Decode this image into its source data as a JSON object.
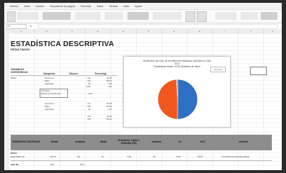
{
  "menu": [
    "Archivo",
    "Inicio",
    "Insertar",
    "Disposición de página",
    "Fórmulas",
    "Datos",
    "Revisar",
    "Vista",
    "Ayuda"
  ],
  "formula": {
    "cell": "J7",
    "fx": "fx",
    "value": ""
  },
  "columns": [
    "A",
    "B",
    "C",
    "D",
    "E",
    "F",
    "G",
    "H",
    "I",
    "J",
    "K"
  ],
  "title": "ESTADÍSTICA DESCRIPTIVA",
  "subtitle": "RESULTADOS",
  "section1": {
    "label": "VARIABLES CATEGÓRICAS",
    "headers": [
      "Categorías",
      "Número",
      "Porcentaje"
    ],
    "var_name": "SEXO",
    "rows": [
      [
        "Femenino",
        "712",
        "49.38"
      ],
      [
        "Masc",
        "730",
        "50.62"
      ],
      [
        "Indefinido",
        "10",
        "1.00"
      ],
      [
        "",
        "1442",
        "100"
      ]
    ]
  },
  "stat_box": {
    "row1": "Indicador",
    "row2": "Razón hombre/mujer",
    "value": "1.03"
  },
  "section1b": {
    "rows": [
      [
        "Femenino",
        "712",
        "49.38"
      ],
      [
        "Masc",
        "730",
        "50.62"
      ],
      [
        "Indefinido",
        "10",
        "1.00"
      ]
    ],
    "extra": [
      [
        "",
        "712",
        "49.38"
      ],
      [
        "",
        "730",
        "50.62"
      ]
    ]
  },
  "chart": {
    "title_line1": "Distribución por sexo de los diferentes individuos ocurridas en Chile",
    "title_line2": "2013",
    "title_line3": "Estadísticas Vitales, 2019, Ministerio de Salud",
    "legend": "Femenino",
    "colors": {
      "slice1": "#2f6fc4",
      "slice2": "#f0581f",
      "slice3": "#8c8c8c"
    }
  },
  "chart_data": {
    "type": "pie",
    "categories": [
      "Masc",
      "Femenino",
      "Indefinido"
    ],
    "values": [
      50.62,
      49.38,
      1.0
    ]
  },
  "section2": {
    "headers": [
      "VARIABLES CONTINUAS",
      "Media",
      "mediana",
      "Moda",
      "Desviación Típica o Estándar (DE)",
      "varianza",
      "CV",
      "%CV",
      "simetría"
    ],
    "row1_label": "EDAD",
    "row2": [
      "Edad Materna",
      "28.74",
      "28",
      "31",
      "7.26",
      "26",
      "0.26",
      "25.57",
      "Asimétrica (heterogeneidad)"
    ],
    "row3": [
      "dias SE",
      "33.2",
      "",
      "33.3",
      "",
      "",
      "",
      "",
      ""
    ]
  }
}
